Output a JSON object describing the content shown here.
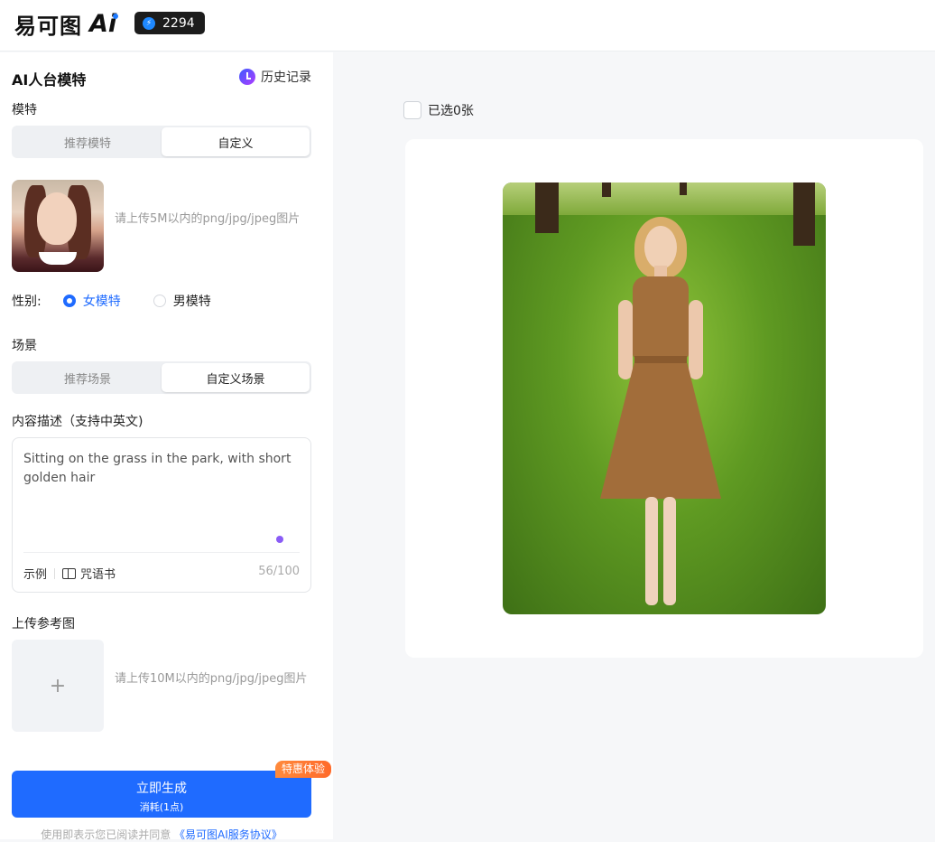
{
  "header": {
    "logo_text": "易可图",
    "logo_ai": "Ai",
    "credits": "2294"
  },
  "panel": {
    "title": "AI人台模特",
    "history_label": "历史记录",
    "model_section": {
      "label": "模特",
      "tabs": [
        "推荐模特",
        "自定义"
      ],
      "active_tab": "自定义",
      "upload_hint": "请上传5M以内的png/jpg/jpeg图片"
    },
    "gender": {
      "label": "性别:",
      "options": [
        "女模特",
        "男模特"
      ],
      "selected": "女模特"
    },
    "scene_section": {
      "label": "场景",
      "tabs": [
        "推荐场景",
        "自定义场景"
      ],
      "active_tab": "自定义场景"
    },
    "description": {
      "label": "内容描述（支持中英文)",
      "value": "Sitting on the grass in the park, with short golden hair",
      "example_label": "示例",
      "spellbook_label": "咒语书",
      "count": "56/100"
    },
    "reference": {
      "label": "上传参考图",
      "plus": "+",
      "upload_hint": "请上传10M以内的png/jpg/jpeg图片"
    },
    "generate": {
      "label": "立即生成",
      "cost": "消耗(1点)",
      "promo": "特惠体验"
    },
    "agreement": {
      "text": "使用即表示您已阅读并同意 ",
      "link": "《易可图AI服务协议》"
    }
  },
  "result": {
    "selected_label": "已选0张"
  },
  "colors": {
    "accent": "#1f6bff",
    "promo": "#ff7a33",
    "badge_bg": "#1c1c1c"
  }
}
